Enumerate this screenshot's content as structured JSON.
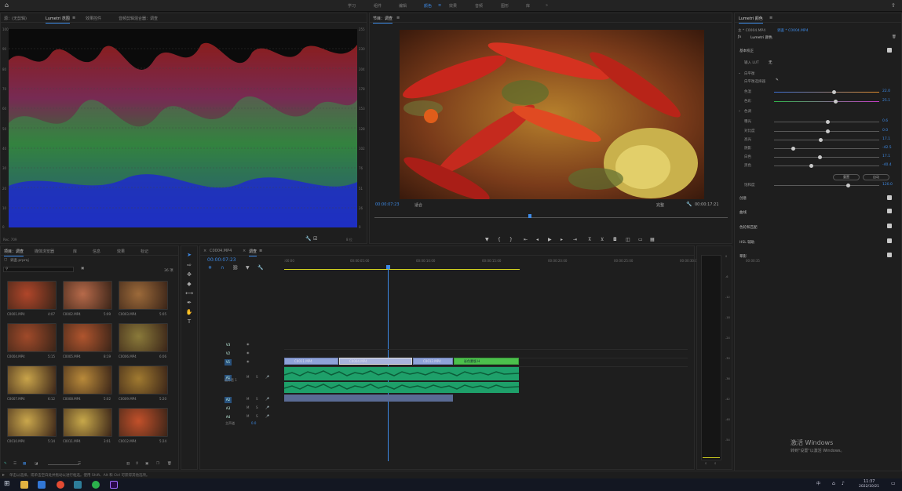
{
  "topbar": {
    "workspaces": [
      "学习",
      "组件",
      "编辑",
      "颜色",
      "效果",
      "音频",
      "图形",
      "库"
    ],
    "active": "颜色"
  },
  "scope": {
    "tabs": [
      "源：(无剪辑)",
      "Lumetri 范围",
      "效果控件",
      "音频剪辑混合器：调查"
    ],
    "left_ticks": [
      "100",
      "90",
      "80",
      "70",
      "60",
      "50",
      "40",
      "30",
      "20",
      "10",
      "0"
    ],
    "right_ticks": [
      "255",
      "230",
      "204",
      "178",
      "153",
      "128",
      "102",
      "76",
      "51",
      "26",
      "0"
    ],
    "bottom_left": "Rec. 709",
    "bottom_right": "8 位"
  },
  "program": {
    "title": "节目：调查",
    "timecode": "00:00:07:23",
    "fit": "适合",
    "quality": "完整",
    "duration": "00:00:17:21"
  },
  "project": {
    "tabs": [
      "项目：调查",
      "媒体浏览器",
      "库",
      "信息",
      "效果",
      "标记"
    ],
    "path": "调查.prproj",
    "count": "36 项",
    "items": [
      {
        "name": "C0001.MP4",
        "dur": "4:07"
      },
      {
        "name": "C0002.MP4",
        "dur": "5:09"
      },
      {
        "name": "C0003.MP4",
        "dur": "5:05"
      },
      {
        "name": "C0004.MP4",
        "dur": "5:15"
      },
      {
        "name": "C0005.MP4",
        "dur": "8:19"
      },
      {
        "name": "C0006.MP4",
        "dur": "6:06"
      },
      {
        "name": "C0007.MP4",
        "dur": "6:12"
      },
      {
        "name": "C0008.MP4",
        "dur": "5:02"
      },
      {
        "name": "C0009.MP4",
        "dur": "5:20"
      },
      {
        "name": "C0010.MP4",
        "dur": "5:14"
      },
      {
        "name": "C0011.MP4",
        "dur": "3:01"
      },
      {
        "name": "C0012.MP4",
        "dur": "5:24"
      }
    ]
  },
  "timeline": {
    "tabs": [
      "C0004.MP4",
      "调查"
    ],
    "timecode": "00:00:07:23",
    "ruler": [
      ":00:00",
      "00:00:05:00",
      "00:00:10:00",
      "00:00:15:00",
      "00:00:20:00",
      "00:00:25:00",
      "00:00:30:00",
      "00:00:35"
    ],
    "video_tracks": [
      "V3",
      "V2",
      "V1"
    ],
    "audio_tracks": [
      "A1",
      "A2",
      "A3",
      "A4"
    ],
    "mix": "主声道",
    "mix_value": "0.0",
    "audio_label": "画外音 1",
    "clips": [
      "C0011.MP4",
      "C0004.MP4",
      "C0012.MP4",
      "彩色蒙版 H"
    ]
  },
  "meter": {
    "ticks": [
      "0",
      "-6",
      "-12",
      "-18",
      "-24",
      "-30",
      "-36",
      "-42",
      "-48",
      "-54"
    ],
    "bottom": [
      "S",
      "S"
    ]
  },
  "lumetri": {
    "title": "Lumetri 颜色",
    "source": "主 * C0004.MP4",
    "sequence": "调查 * C0004.MP4",
    "effect": "Lumetri 颜色",
    "basic": "基本校正",
    "lut_label": "输入 LUT",
    "lut_value": "无",
    "wb": "白平衡",
    "wb_picker": "白平衡选择器",
    "tone": "色调",
    "sliders": [
      {
        "name": "色温",
        "value": "22.0",
        "pos": 0.57
      },
      {
        "name": "色彩",
        "value": "25.1",
        "pos": 0.58
      },
      {
        "name": "曝光",
        "value": "0.6",
        "pos": 0.51
      },
      {
        "name": "对比度",
        "value": "0.0",
        "pos": 0.51
      },
      {
        "name": "高光",
        "value": "17.1",
        "pos": 0.44
      },
      {
        "name": "阴影",
        "value": "-42.5",
        "pos": 0.18
      },
      {
        "name": "白色",
        "value": "17.1",
        "pos": 0.43
      },
      {
        "name": "黑色",
        "value": "-40.4",
        "pos": 0.35
      },
      {
        "name": "饱和度",
        "value": "120.0",
        "pos": 0.7
      }
    ],
    "reset": "重置",
    "auto": "自动",
    "sections": [
      "创意",
      "曲线",
      "色轮和匹配",
      "HSL 辅助",
      "晕影"
    ]
  },
  "status": {
    "text": "单击以选择，或单击空白处并拖动以进行框选。使用 Shift、Alt 和 Ctrl 可获得其他选项。"
  },
  "watermark": {
    "line1": "激活 Windows",
    "line2": "转到\"设置\"以激活 Windows。"
  },
  "taskbar": {
    "time": "11:37",
    "date": "2022/10/21",
    "lang": "中"
  },
  "colors": {
    "accent": "#3d8ae6",
    "clip_video": "#8fa3d9",
    "clip_matte": "#4cc04c",
    "audio": "#21b87a"
  }
}
